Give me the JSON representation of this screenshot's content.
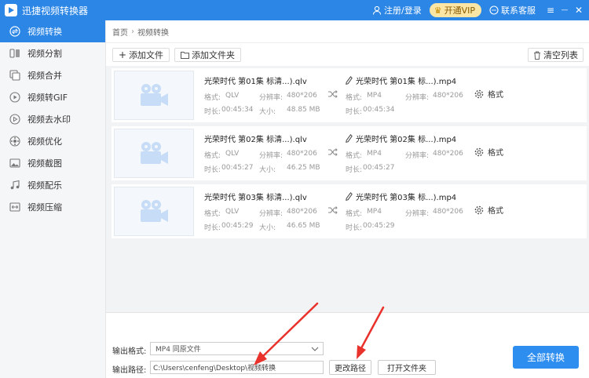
{
  "app": {
    "title": "迅捷视频转换器"
  },
  "titlebar": {
    "login": "注册/登录",
    "vip": "开通VIP",
    "service": "联系客服",
    "menu": "≡",
    "minimize": "—",
    "close": "✕"
  },
  "sidebar": {
    "items": [
      {
        "label": "视频转换",
        "icon": "convert-icon",
        "active": true
      },
      {
        "label": "视频分割",
        "icon": "split-icon"
      },
      {
        "label": "视频合并",
        "icon": "merge-icon"
      },
      {
        "label": "视频转GIF",
        "icon": "gif-icon"
      },
      {
        "label": "视频去水印",
        "icon": "watermark-icon"
      },
      {
        "label": "视频优化",
        "icon": "optimize-icon"
      },
      {
        "label": "视频截图",
        "icon": "screenshot-icon"
      },
      {
        "label": "视频配乐",
        "icon": "music-icon"
      },
      {
        "label": "视频压缩",
        "icon": "compress-icon"
      }
    ]
  },
  "breadcrumb": {
    "home": "首页",
    "sep": "›",
    "current": "视频转换"
  },
  "toolbar": {
    "add_file": "添加文件",
    "add_folder": "添加文件夹",
    "clear_list": "清空列表"
  },
  "labels": {
    "format": "格式:",
    "resolution": "分辨率:",
    "duration": "时长:",
    "size": "大小:",
    "format_btn": "格式"
  },
  "files": [
    {
      "src_name": "光荣时代 第01集 标清...).qlv",
      "src_format": "QLV",
      "src_res": "480*206",
      "src_duration": "00:45:34",
      "src_size": "48.85 MB",
      "dst_name": "光荣时代 第01集 标...).mp4",
      "dst_format": "MP4",
      "dst_res": "480*206",
      "dst_duration": "00:45:34"
    },
    {
      "src_name": "光荣时代 第02集 标清...).qlv",
      "src_format": "QLV",
      "src_res": "480*206",
      "src_duration": "00:45:27",
      "src_size": "46.25 MB",
      "dst_name": "光荣时代 第02集 标...).mp4",
      "dst_format": "MP4",
      "dst_res": "480*206",
      "dst_duration": "00:45:27"
    },
    {
      "src_name": "光荣时代 第03集 标清...).qlv",
      "src_format": "QLV",
      "src_res": "480*206",
      "src_duration": "00:45:29",
      "src_size": "46.65 MB",
      "dst_name": "光荣时代 第03集 标...).mp4",
      "dst_format": "MP4",
      "dst_res": "480*206",
      "dst_duration": "00:45:29"
    }
  ],
  "bottom": {
    "output_format_label": "输出格式:",
    "output_format_value": "MP4  同原文件",
    "output_path_label": "输出路径:",
    "output_path_value": "C:\\Users\\cenfeng\\Desktop\\视频转换",
    "change_path": "更改路径",
    "open_folder": "打开文件夹",
    "convert_all": "全部转换"
  },
  "colors": {
    "accent": "#2b86e6",
    "annotation": "#e8322b"
  }
}
